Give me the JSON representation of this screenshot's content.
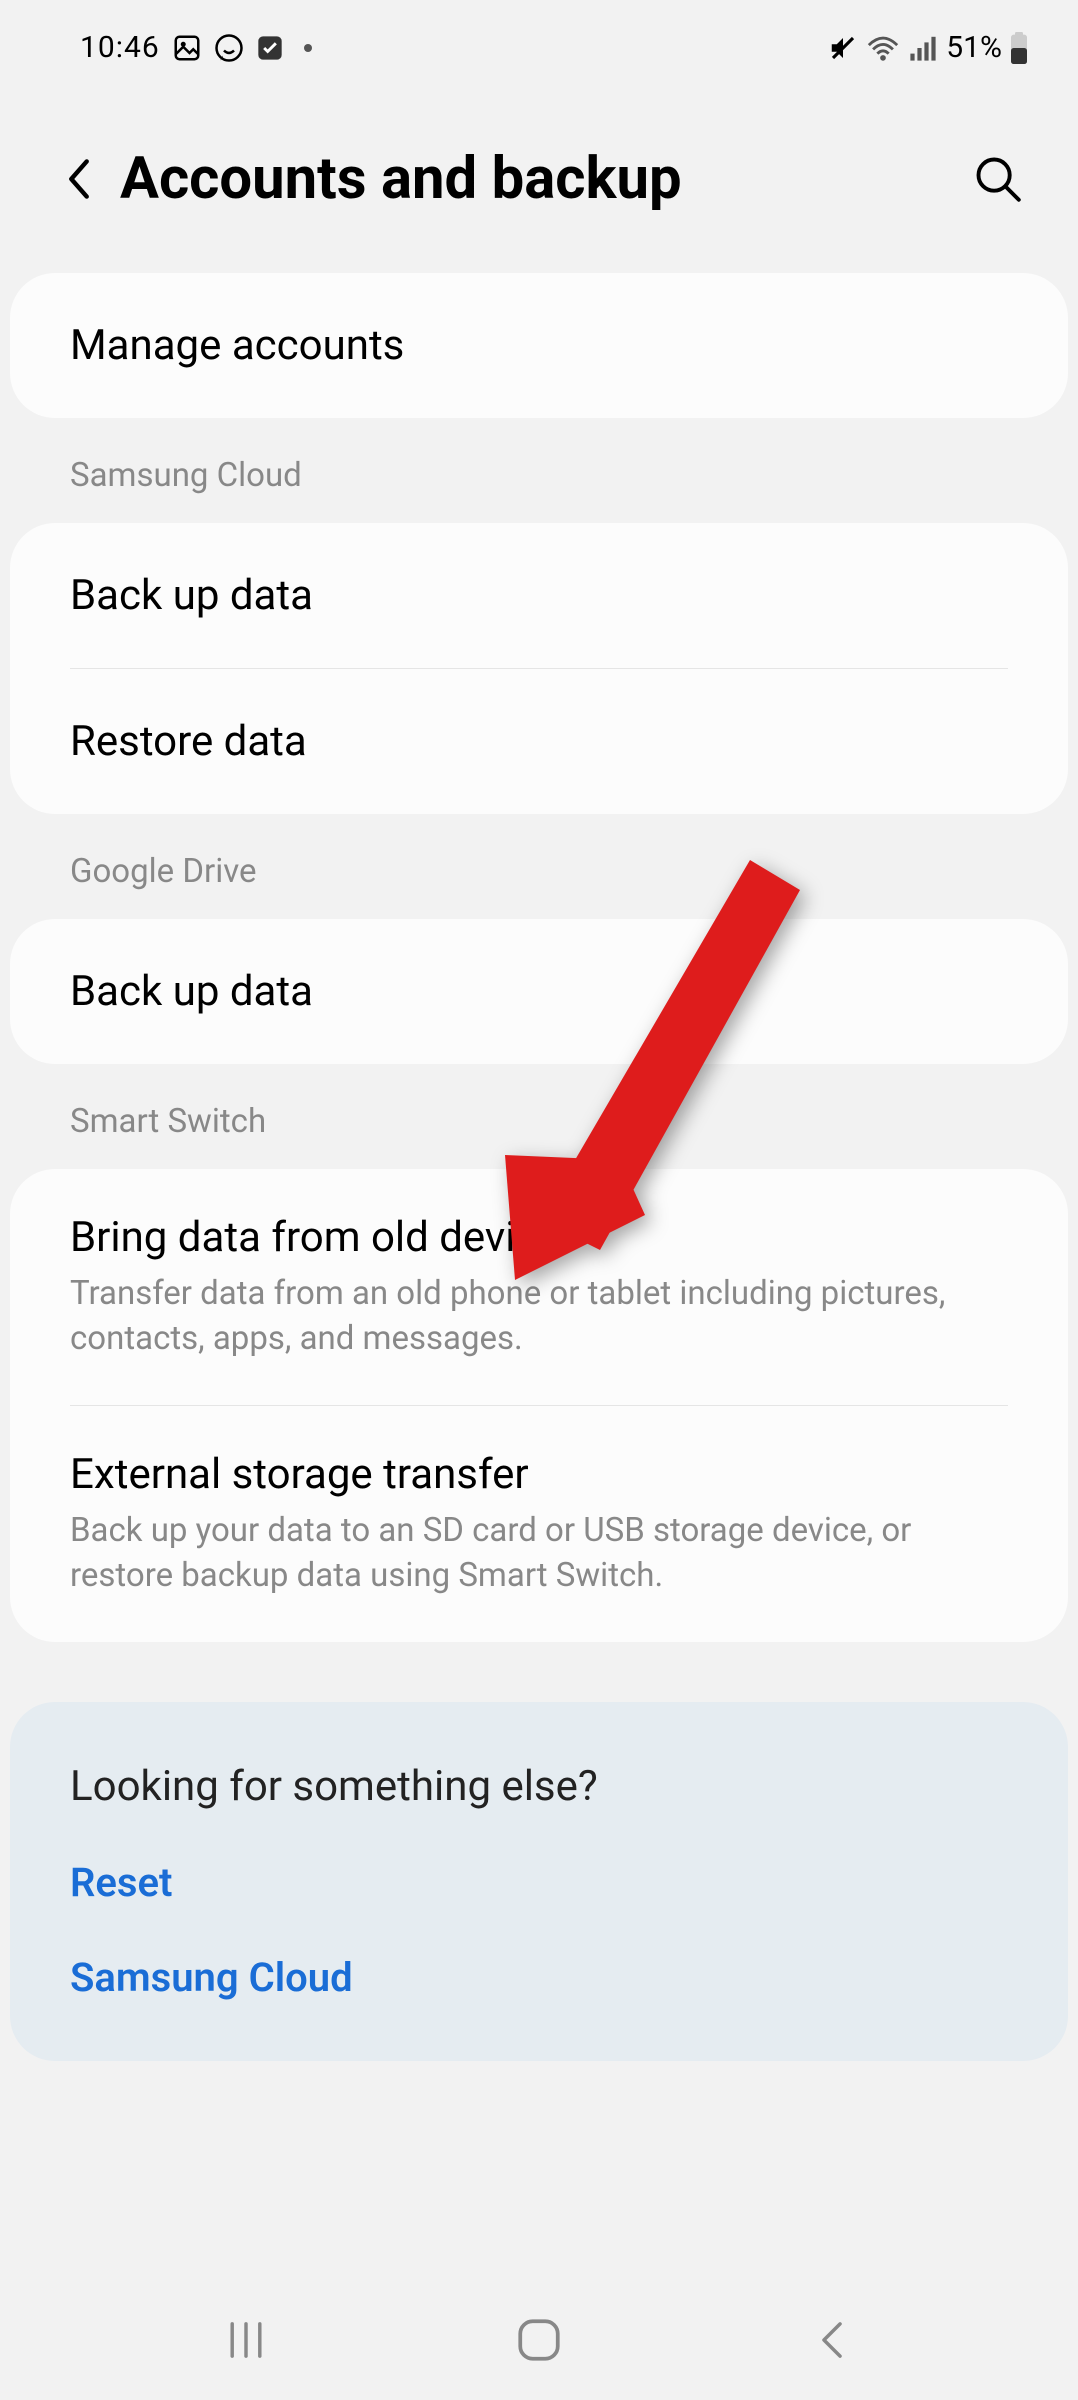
{
  "status": {
    "time": "10:46",
    "battery": "51%"
  },
  "header": {
    "title": "Accounts and backup"
  },
  "sections": {
    "manage_accounts": "Manage accounts",
    "samsung_cloud": {
      "label": "Samsung Cloud",
      "backup": "Back up data",
      "restore": "Restore data"
    },
    "google_drive": {
      "label": "Google Drive",
      "backup": "Back up data"
    },
    "smart_switch": {
      "label": "Smart Switch",
      "bring_title": "Bring data from old device",
      "bring_sub": "Transfer data from an old phone or tablet including pictures, contacts, apps, and messages.",
      "external_title": "External storage transfer",
      "external_sub": "Back up your data to an SD card or USB storage device, or restore backup data using Smart Switch."
    }
  },
  "hint": {
    "title": "Looking for something else?",
    "links": [
      "Reset",
      "Samsung Cloud"
    ]
  },
  "annotation": {
    "arrow_color": "#de1c1c"
  }
}
